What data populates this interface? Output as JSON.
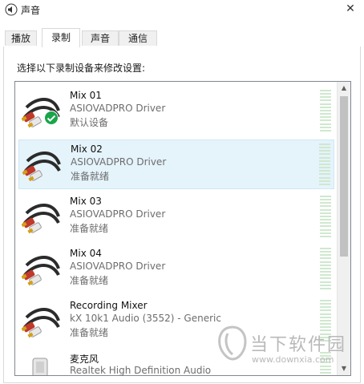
{
  "window": {
    "title": "声音",
    "close_glyph": "✕"
  },
  "tabs": [
    {
      "label": "播放",
      "active": false
    },
    {
      "label": "录制",
      "active": true
    },
    {
      "label": "声音",
      "active": false
    },
    {
      "label": "通信",
      "active": false
    }
  ],
  "instruction": "选择以下录制设备来修改设置:",
  "devices": [
    {
      "name": "Mix 01",
      "driver": "ASIOVADPRO Driver",
      "status": "默认设备",
      "default": true,
      "selected": false,
      "icon": "rca-cable-icon"
    },
    {
      "name": "Mix 02",
      "driver": "ASIOVADPRO Driver",
      "status": "准备就绪",
      "default": false,
      "selected": true,
      "icon": "rca-cable-icon"
    },
    {
      "name": "Mix 03",
      "driver": "ASIOVADPRO Driver",
      "status": "准备就绪",
      "default": false,
      "selected": false,
      "icon": "rca-cable-icon"
    },
    {
      "name": "Mix 04",
      "driver": "ASIOVADPRO Driver",
      "status": "准备就绪",
      "default": false,
      "selected": false,
      "icon": "rca-cable-icon"
    },
    {
      "name": "Recording Mixer",
      "driver": "kX 10k1 Audio (3552) - Generic",
      "status": "准备就绪",
      "default": false,
      "selected": false,
      "icon": "rca-cable-icon"
    },
    {
      "name": "麦克风",
      "driver": "Realtek High Definition Audio",
      "status": "",
      "default": false,
      "selected": false,
      "icon": "microphone-icon"
    }
  ],
  "scrollbar": {
    "up_glyph": "▲",
    "down_glyph": "▼"
  },
  "watermark": {
    "brand": "当下软件园",
    "url": "www.downxia.com"
  },
  "colors": {
    "selected_bg": "#e5f3fb",
    "meter": "#cfe8cf",
    "check": "#1aa54a",
    "plug_red": "#c0392b",
    "plug_gold": "#d4a017"
  }
}
